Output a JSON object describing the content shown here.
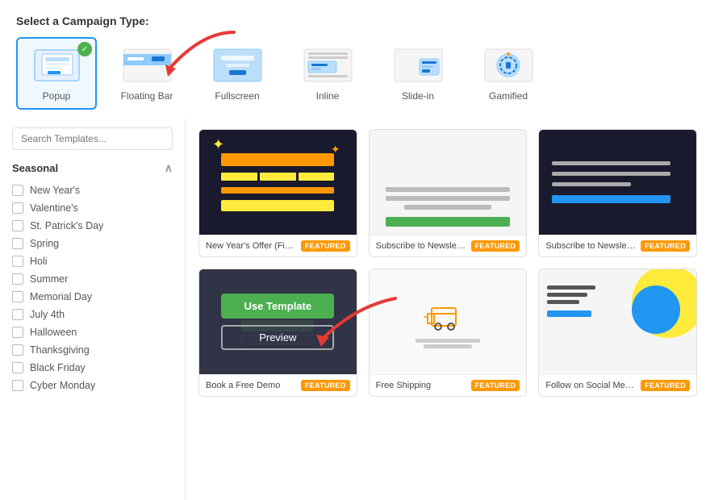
{
  "header": {
    "title": "Select a Campaign Type:"
  },
  "campaignTypes": [
    {
      "id": "popup",
      "label": "Popup",
      "selected": true
    },
    {
      "id": "floating-bar",
      "label": "Floating Bar",
      "selected": false
    },
    {
      "id": "fullscreen",
      "label": "Fullscreen",
      "selected": false
    },
    {
      "id": "inline",
      "label": "Inline",
      "selected": false
    },
    {
      "id": "slide-in",
      "label": "Slide-in",
      "selected": false
    },
    {
      "id": "gamified",
      "label": "Gamified",
      "selected": false
    }
  ],
  "sidebar": {
    "searchPlaceholder": "Search Templates...",
    "seasonalSection": "Seasonal",
    "seasonalItems": [
      "New Year's",
      "Valentine's",
      "St. Patrick's Day",
      "Spring",
      "Holi",
      "Summer",
      "Memorial Day",
      "July 4th",
      "Halloween",
      "Thanksgiving",
      "Black Friday",
      "Cyber Monday"
    ]
  },
  "templates": [
    {
      "id": "new-years-fireworks",
      "name": "New Year's Offer (Firewo...",
      "featured": true,
      "type": "fireworks",
      "hasOverlay": false
    },
    {
      "id": "subscribe-newsletter-1",
      "name": "Subscribe to Newsletter ...",
      "featured": true,
      "type": "newsletter-light",
      "hasOverlay": false
    },
    {
      "id": "subscribe-newsletter-2",
      "name": "Subscribe to Newsletter ...",
      "featured": true,
      "type": "newsletter-dark",
      "hasOverlay": false
    },
    {
      "id": "book-free-demo",
      "name": "Book a Free Demo",
      "featured": true,
      "type": "demo",
      "hasOverlay": true
    },
    {
      "id": "free-shipping",
      "name": "Free Shipping",
      "featured": true,
      "type": "shipping",
      "hasOverlay": false
    },
    {
      "id": "follow-social-media",
      "name": "Follow on Social Media",
      "featured": true,
      "type": "social",
      "hasOverlay": false
    }
  ],
  "buttons": {
    "useTemplate": "Use Template",
    "preview": "Preview"
  },
  "badges": {
    "featured": "FEATURED"
  }
}
